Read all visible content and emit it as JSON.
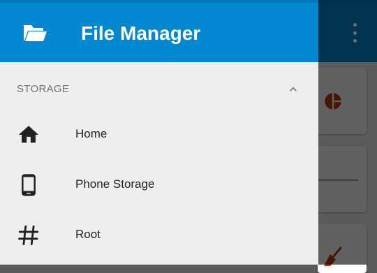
{
  "app": {
    "title": "File Manager"
  },
  "drawer": {
    "section": {
      "label": "STORAGE"
    },
    "items": [
      {
        "label": "Home",
        "icon": "home-icon"
      },
      {
        "label": "Phone Storage",
        "icon": "phone-icon"
      },
      {
        "label": "Root",
        "icon": "hash-icon"
      }
    ]
  },
  "colors": {
    "primary": "#0288d1",
    "status_bar": "#0277bd",
    "drawer_bg": "#eeeeee",
    "accent_icon": "#bf360c"
  }
}
